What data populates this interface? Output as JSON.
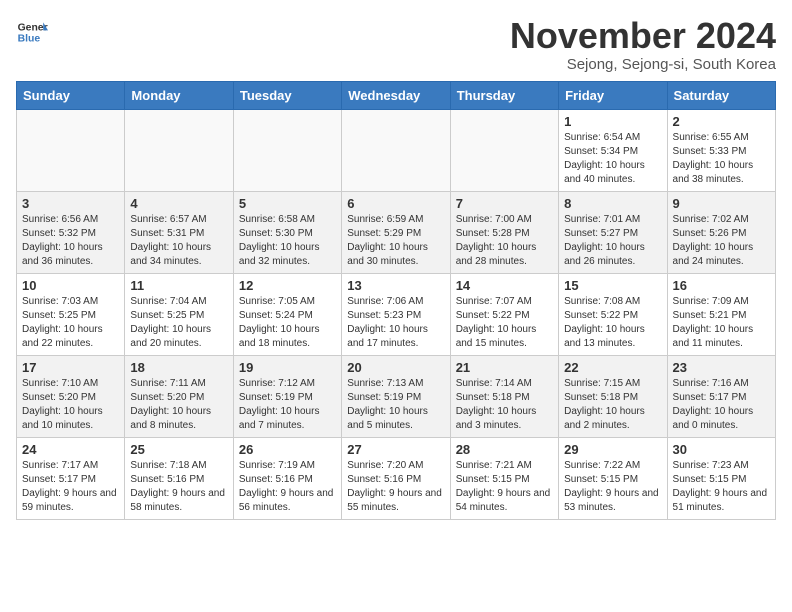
{
  "logo": {
    "general": "General",
    "blue": "Blue",
    "tagline": ""
  },
  "header": {
    "month": "November 2024",
    "location": "Sejong, Sejong-si, South Korea"
  },
  "weekdays": [
    "Sunday",
    "Monday",
    "Tuesday",
    "Wednesday",
    "Thursday",
    "Friday",
    "Saturday"
  ],
  "weeks": [
    [
      {
        "day": "",
        "info": ""
      },
      {
        "day": "",
        "info": ""
      },
      {
        "day": "",
        "info": ""
      },
      {
        "day": "",
        "info": ""
      },
      {
        "day": "",
        "info": ""
      },
      {
        "day": "1",
        "info": "Sunrise: 6:54 AM\nSunset: 5:34 PM\nDaylight: 10 hours and 40 minutes."
      },
      {
        "day": "2",
        "info": "Sunrise: 6:55 AM\nSunset: 5:33 PM\nDaylight: 10 hours and 38 minutes."
      }
    ],
    [
      {
        "day": "3",
        "info": "Sunrise: 6:56 AM\nSunset: 5:32 PM\nDaylight: 10 hours and 36 minutes."
      },
      {
        "day": "4",
        "info": "Sunrise: 6:57 AM\nSunset: 5:31 PM\nDaylight: 10 hours and 34 minutes."
      },
      {
        "day": "5",
        "info": "Sunrise: 6:58 AM\nSunset: 5:30 PM\nDaylight: 10 hours and 32 minutes."
      },
      {
        "day": "6",
        "info": "Sunrise: 6:59 AM\nSunset: 5:29 PM\nDaylight: 10 hours and 30 minutes."
      },
      {
        "day": "7",
        "info": "Sunrise: 7:00 AM\nSunset: 5:28 PM\nDaylight: 10 hours and 28 minutes."
      },
      {
        "day": "8",
        "info": "Sunrise: 7:01 AM\nSunset: 5:27 PM\nDaylight: 10 hours and 26 minutes."
      },
      {
        "day": "9",
        "info": "Sunrise: 7:02 AM\nSunset: 5:26 PM\nDaylight: 10 hours and 24 minutes."
      }
    ],
    [
      {
        "day": "10",
        "info": "Sunrise: 7:03 AM\nSunset: 5:25 PM\nDaylight: 10 hours and 22 minutes."
      },
      {
        "day": "11",
        "info": "Sunrise: 7:04 AM\nSunset: 5:25 PM\nDaylight: 10 hours and 20 minutes."
      },
      {
        "day": "12",
        "info": "Sunrise: 7:05 AM\nSunset: 5:24 PM\nDaylight: 10 hours and 18 minutes."
      },
      {
        "day": "13",
        "info": "Sunrise: 7:06 AM\nSunset: 5:23 PM\nDaylight: 10 hours and 17 minutes."
      },
      {
        "day": "14",
        "info": "Sunrise: 7:07 AM\nSunset: 5:22 PM\nDaylight: 10 hours and 15 minutes."
      },
      {
        "day": "15",
        "info": "Sunrise: 7:08 AM\nSunset: 5:22 PM\nDaylight: 10 hours and 13 minutes."
      },
      {
        "day": "16",
        "info": "Sunrise: 7:09 AM\nSunset: 5:21 PM\nDaylight: 10 hours and 11 minutes."
      }
    ],
    [
      {
        "day": "17",
        "info": "Sunrise: 7:10 AM\nSunset: 5:20 PM\nDaylight: 10 hours and 10 minutes."
      },
      {
        "day": "18",
        "info": "Sunrise: 7:11 AM\nSunset: 5:20 PM\nDaylight: 10 hours and 8 minutes."
      },
      {
        "day": "19",
        "info": "Sunrise: 7:12 AM\nSunset: 5:19 PM\nDaylight: 10 hours and 7 minutes."
      },
      {
        "day": "20",
        "info": "Sunrise: 7:13 AM\nSunset: 5:19 PM\nDaylight: 10 hours and 5 minutes."
      },
      {
        "day": "21",
        "info": "Sunrise: 7:14 AM\nSunset: 5:18 PM\nDaylight: 10 hours and 3 minutes."
      },
      {
        "day": "22",
        "info": "Sunrise: 7:15 AM\nSunset: 5:18 PM\nDaylight: 10 hours and 2 minutes."
      },
      {
        "day": "23",
        "info": "Sunrise: 7:16 AM\nSunset: 5:17 PM\nDaylight: 10 hours and 0 minutes."
      }
    ],
    [
      {
        "day": "24",
        "info": "Sunrise: 7:17 AM\nSunset: 5:17 PM\nDaylight: 9 hours and 59 minutes."
      },
      {
        "day": "25",
        "info": "Sunrise: 7:18 AM\nSunset: 5:16 PM\nDaylight: 9 hours and 58 minutes."
      },
      {
        "day": "26",
        "info": "Sunrise: 7:19 AM\nSunset: 5:16 PM\nDaylight: 9 hours and 56 minutes."
      },
      {
        "day": "27",
        "info": "Sunrise: 7:20 AM\nSunset: 5:16 PM\nDaylight: 9 hours and 55 minutes."
      },
      {
        "day": "28",
        "info": "Sunrise: 7:21 AM\nSunset: 5:15 PM\nDaylight: 9 hours and 54 minutes."
      },
      {
        "day": "29",
        "info": "Sunrise: 7:22 AM\nSunset: 5:15 PM\nDaylight: 9 hours and 53 minutes."
      },
      {
        "day": "30",
        "info": "Sunrise: 7:23 AM\nSunset: 5:15 PM\nDaylight: 9 hours and 51 minutes."
      }
    ]
  ]
}
